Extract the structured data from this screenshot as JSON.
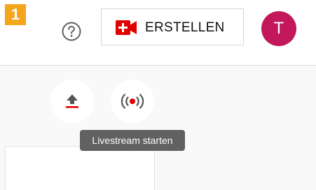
{
  "step_badge": {
    "number": "1",
    "color": "#f3a51b"
  },
  "header": {
    "help_icon": "question-circle-icon",
    "create_button": {
      "label": "ERSTELLEN",
      "icon": "video-camera-plus-icon",
      "icon_color": "#e00000"
    },
    "avatar": {
      "initial": "T",
      "color": "#c2185b"
    }
  },
  "actions": {
    "upload_icon": "upload-icon",
    "live_icon": "live-broadcast-icon",
    "tooltip": "Livestream starten"
  }
}
